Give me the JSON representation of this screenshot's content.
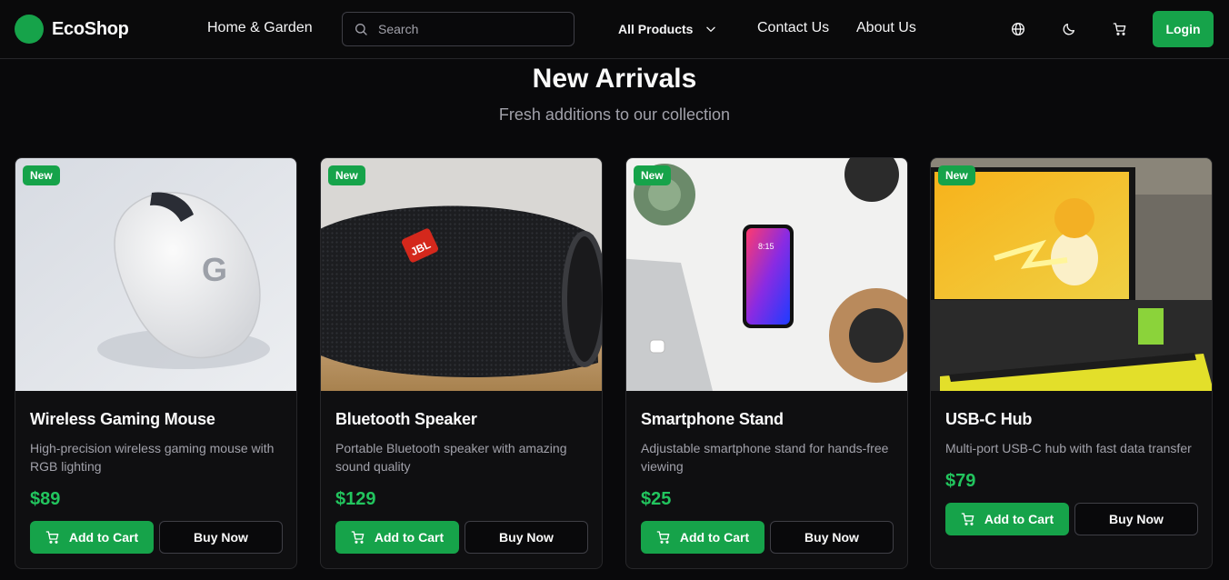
{
  "brand": {
    "name": "EcoShop",
    "accent": "#16a34a",
    "price_color": "#22c55e"
  },
  "nav": {
    "home_garden": "Home & Garden",
    "search_placeholder": "Search",
    "products_dropdown": "All Products",
    "contact": "Contact Us",
    "about": "About Us",
    "icons": [
      "globe-icon",
      "moon-icon",
      "cart-icon"
    ],
    "login": "Login"
  },
  "section": {
    "title": "New Arrivals",
    "subtitle": "Fresh additions to our collection"
  },
  "products": [
    {
      "badge": "New",
      "name": "Wireless Gaming Mouse",
      "description": "High-precision wireless gaming mouse with RGB lighting",
      "price": "$89",
      "add_to_cart": "Add to Cart",
      "buy_now": "Buy Now",
      "image_logo_text": "G"
    },
    {
      "badge": "New",
      "name": "Bluetooth Speaker",
      "description": "Portable Bluetooth speaker with amazing sound quality",
      "price": "$129",
      "add_to_cart": "Add to Cart",
      "buy_now": "Buy Now",
      "image_logo_text": "JBL"
    },
    {
      "badge": "New",
      "name": "Smartphone Stand",
      "description": "Adjustable smartphone stand for hands-free viewing",
      "price": "$25",
      "add_to_cart": "Add to Cart",
      "buy_now": "Buy Now",
      "image_logo_text": "8:15"
    },
    {
      "badge": "New",
      "name": "USB-C Hub",
      "description": "Multi-port USB-C hub with fast data transfer",
      "price": "$79",
      "add_to_cart": "Add to Cart",
      "buy_now": "Buy Now"
    }
  ]
}
